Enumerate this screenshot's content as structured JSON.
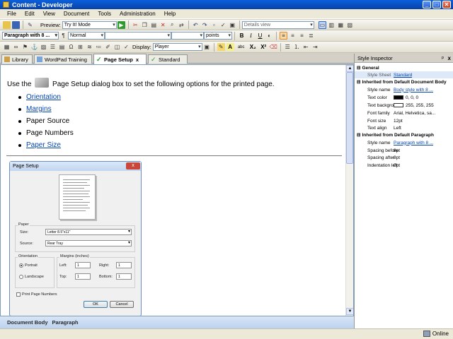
{
  "window": {
    "title": "Content - Developer",
    "minimize": "_",
    "maximize": "□",
    "close": "✕"
  },
  "menu": [
    "File",
    "Edit",
    "View",
    "Document",
    "Tools",
    "Administration",
    "Help"
  ],
  "toolbar1": {
    "preview_label": "Preview:",
    "preview_mode": "Try It! Mode",
    "view_select": "Details view"
  },
  "toolbar2": {
    "paragraph_style": "Paragraph with 8 ...",
    "char_style": "Normal",
    "font": "",
    "size": "",
    "units": "points",
    "bold": "B",
    "italic": "I",
    "underline": "U"
  },
  "toolbar3": {
    "display_label": "Display:",
    "display_value": "Player",
    "highlight": "A",
    "abc": "abc",
    "subscript": "X₂",
    "superscript": "X²"
  },
  "tabs": [
    {
      "label": "Library",
      "active": false
    },
    {
      "label": "WordPad Training",
      "active": false
    },
    {
      "label": "Page Setup",
      "active": true
    },
    {
      "label": "Standard",
      "active": false
    }
  ],
  "document": {
    "intro_before": "Use the",
    "intro_after": "Page Setup dialog box to set the following options for the printed page.",
    "items": [
      {
        "text": "Orientation",
        "link": true
      },
      {
        "text": "Margins",
        "link": true
      },
      {
        "text": "Paper Source",
        "link": false
      },
      {
        "text": "Page Numbers",
        "link": false
      },
      {
        "text": "Paper Size",
        "link": true
      }
    ]
  },
  "dialog": {
    "title": "Page Setup",
    "close": "x",
    "paper_group": "Paper",
    "size_label": "Size:",
    "size_value": "Letter 8.5\"x11\"",
    "source_label": "Source:",
    "source_value": "Rear Tray",
    "orientation_group": "Orientation",
    "portrait": "Portrait",
    "landscape": "Landscape",
    "margins_group": "Margins (inches)",
    "left_label": "Left:",
    "left_value": "1",
    "right_label": "Right:",
    "right_value": "1",
    "top_label": "Top:",
    "top_value": "1",
    "bottom_label": "Bottom:",
    "bottom_value": "1",
    "print_numbers": "Print Page Numbers",
    "ok": "OK",
    "cancel": "Cancel"
  },
  "pathbar": [
    "Document Body",
    "Paragraph"
  ],
  "status": {
    "online": "Online"
  },
  "inspector": {
    "title": "Style Inspector",
    "pin": "ᵖ",
    "close": "x",
    "general": "General",
    "style_sheet_key": "Style Sheet",
    "style_sheet_val": "Standard",
    "doc_section": "Inherited from Default Document Body",
    "doc_rows": [
      {
        "k": "Style name",
        "v": "Body style with 8 ...",
        "link": true
      },
      {
        "k": "Text color",
        "v": "0, 0, 0",
        "swatch": "#000000"
      },
      {
        "k": "Text background",
        "v": "255, 255, 255",
        "swatch": "#ffffff"
      },
      {
        "k": "Font family",
        "v": "Arial, Helvetica, sa..."
      },
      {
        "k": "Font size",
        "v": "12pt"
      },
      {
        "k": "Text align",
        "v": "Left"
      }
    ],
    "para_section": "Inherited from Default Paragraph",
    "para_rows": [
      {
        "k": "Style name",
        "v": "Paragraph with 8 ...",
        "link": true
      },
      {
        "k": "Spacing before",
        "v": "8pt"
      },
      {
        "k": "Spacing after",
        "v": "8pt"
      },
      {
        "k": "Indentation left",
        "v": "0pt"
      }
    ]
  }
}
